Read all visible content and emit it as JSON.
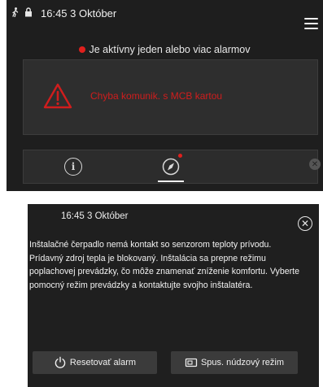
{
  "top_screen": {
    "status": {
      "time": "16:45 3 Október"
    },
    "alarm_banner": "Je aktívny jeden alebo viac alarmov",
    "alarm_card_text": "Chyba komunik. s MCB kartou",
    "tab_info_glyph": "i",
    "colors": {
      "background": "#1e1e1e",
      "alarm_red": "#e0201d",
      "card": "#2e2e2e"
    }
  },
  "dialog": {
    "time": "16:45 3  Október",
    "close_glyph": "✕",
    "message": "Inštalačné čerpadlo nemá kontakt so senzorom teploty prívodu. Prídavný zdroj tepla je blokovaný. Inštalácia sa prepne režimu poplachovej prevádzky, čo môže znamenať zníženie komfortu. Vyberte pomocný režim prevádzky a kontaktujte svojho inštalatéra.",
    "buttons": {
      "reset": {
        "label": "Resetovať alarm",
        "icon": "power-icon"
      },
      "emergency": {
        "label": "Spus. núdzový režim",
        "icon": "emergency-mode-icon"
      }
    },
    "colors": {
      "background": "#1f1f1f",
      "button": "#3b3b3b"
    }
  }
}
